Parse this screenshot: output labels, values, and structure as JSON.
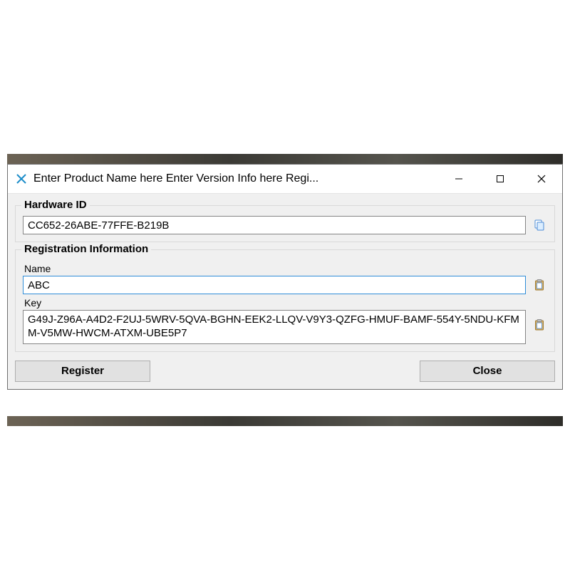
{
  "window": {
    "title": "Enter Product Name here Enter Version Info here Regi..."
  },
  "hardware_id": {
    "group_label": "Hardware ID",
    "value": "CC652-26ABE-77FFE-B219B"
  },
  "registration": {
    "group_label": "Registration Information",
    "name_label": "Name",
    "name_value": "ABC",
    "key_label": "Key",
    "key_value": "G49J-Z96A-A4D2-F2UJ-5WRV-5QVA-BGHN-EEK2-LLQV-V9Y3-QZFG-HMUF-BAMF-554Y-5NDU-KFMM-V5MW-HWCM-ATXM-UBE5P7"
  },
  "buttons": {
    "register": "Register",
    "close": "Close"
  }
}
